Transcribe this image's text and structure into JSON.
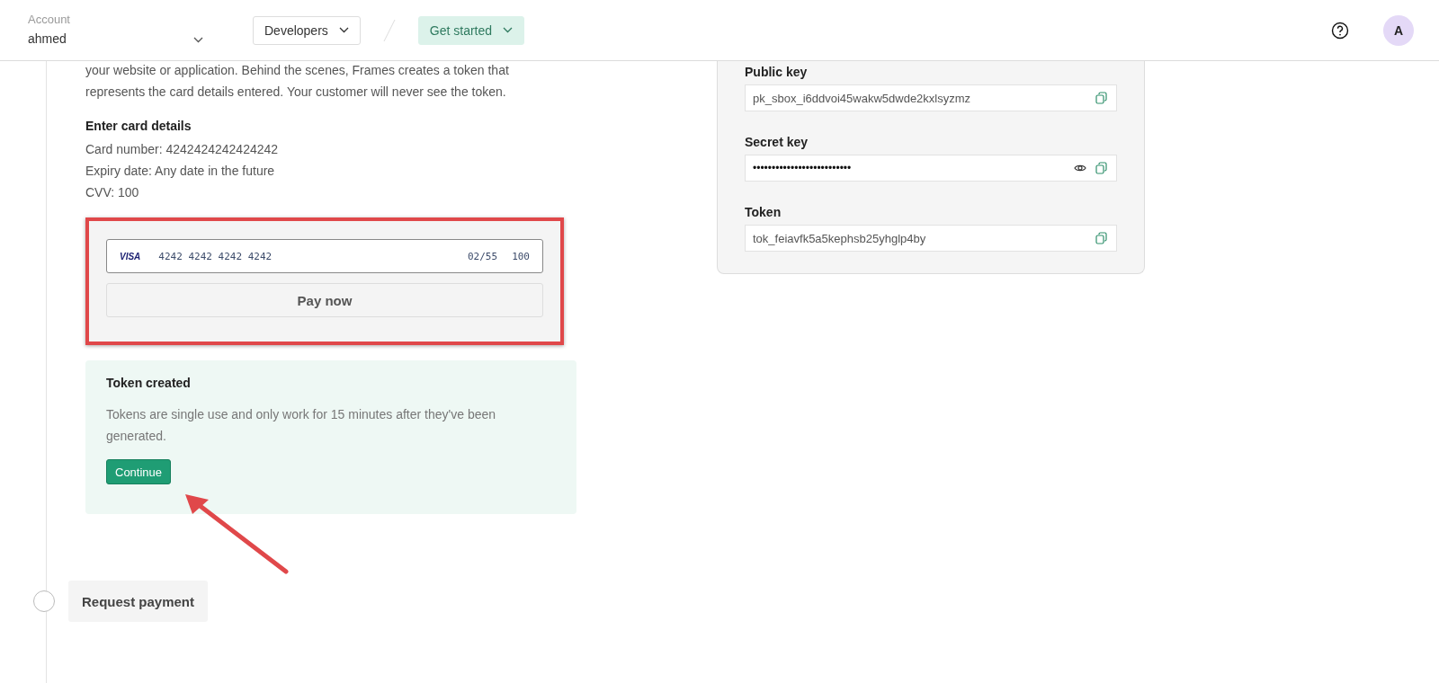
{
  "header": {
    "account_label": "Account",
    "account_name": "ahmed",
    "nav": [
      {
        "label": "Developers",
        "selected": false
      },
      {
        "label": "Get started",
        "selected": true
      }
    ],
    "avatar_letter": "A"
  },
  "intro": "your website or application. Behind the scenes, Frames creates a token that represents the card details entered. Your customer will never see the token.",
  "card_details": {
    "title": "Enter card details",
    "lines": [
      "Card number: 4242424242424242",
      "Expiry date: Any date in the future",
      "CVV: 100"
    ]
  },
  "card_form": {
    "brand": "VISA",
    "number": "4242 4242 4242 4242",
    "expiry": "02/55",
    "cvv": "100",
    "button": "Pay now"
  },
  "token_created": {
    "title": "Token created",
    "text": "Tokens are single use and only work for 15 minutes after they've been generated.",
    "button": "Continue"
  },
  "next_step": {
    "label": "Request payment",
    "completed": false
  },
  "keys": [
    {
      "label": "Public key",
      "value": "pk_sbox_i6ddvoi45wakw5dwde2kxlsyzmz",
      "masked": false
    },
    {
      "label": "Secret key",
      "value": "••••••••••••••••••••••••••",
      "masked": true
    },
    {
      "label": "Token",
      "value": "tok_feiavfk5a5kephsb25yhglp4by",
      "masked": false
    }
  ]
}
